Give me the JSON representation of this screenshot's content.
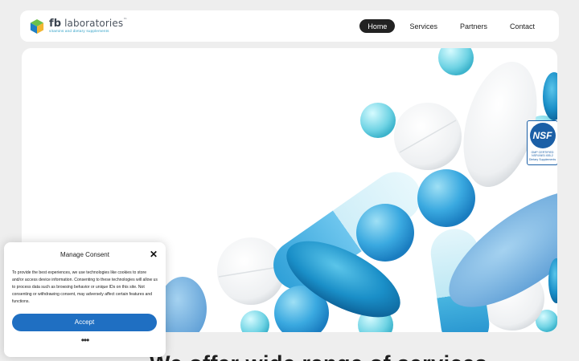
{
  "header": {
    "logo": {
      "main_prefix": "fb",
      "main_suffix": "laboratories",
      "tm": "™",
      "tagline": "vitamins and dietary supplements"
    },
    "nav": [
      {
        "label": "Home",
        "active": true
      },
      {
        "label": "Services",
        "active": false
      },
      {
        "label": "Partners",
        "active": false
      },
      {
        "label": "Contact",
        "active": false
      }
    ]
  },
  "hero": {
    "badge": {
      "brand": "NSF",
      "line1": "GMP CERTIFIED",
      "line2": "NSF/ANSI 455-2",
      "line3": "Dietary Supplements"
    }
  },
  "main": {
    "heading": "We offer wide range of services"
  },
  "consent": {
    "title": "Manage Consent",
    "body": "To provide the best experiences, we use technologies like cookies to store and/or access device information. Consenting to these technologies will allow us to process data such as browsing behavior or unique IDs on this site. Not consenting or withdrawing consent, may adversely affect certain features and functions.",
    "accept_label": "Accept",
    "more_label": "•••",
    "close_label": "✕"
  },
  "colors": {
    "accent": "#1f6fc2",
    "nav_active_bg": "#222222",
    "background": "#eeeeee"
  }
}
